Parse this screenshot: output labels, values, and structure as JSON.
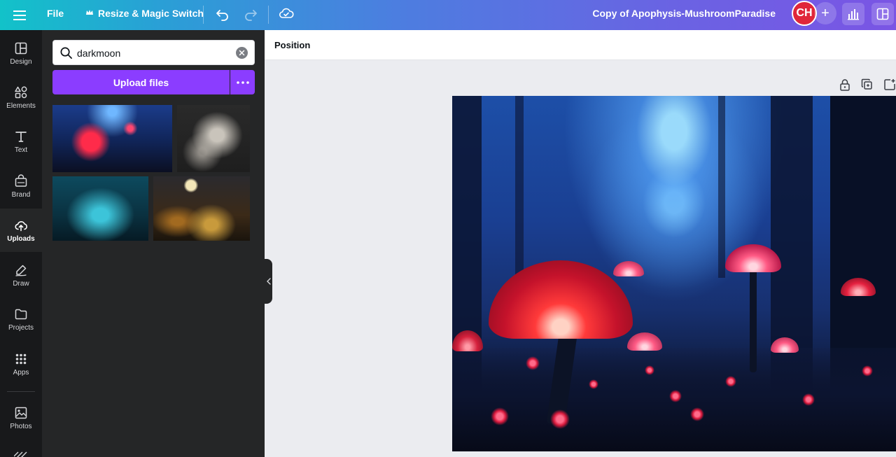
{
  "topbar": {
    "file_label": "File",
    "resize_label": "Resize & Magic Switch",
    "title": "Copy of Apophysis-MushroomParadise",
    "avatar_initials": "CH"
  },
  "rail": {
    "items": [
      {
        "id": "design",
        "label": "Design",
        "icon": "design-icon"
      },
      {
        "id": "elements",
        "label": "Elements",
        "icon": "elements-icon"
      },
      {
        "id": "text",
        "label": "Text",
        "icon": "text-icon"
      },
      {
        "id": "brand",
        "label": "Brand",
        "icon": "brand-icon"
      },
      {
        "id": "uploads",
        "label": "Uploads",
        "icon": "cloud-upload-icon",
        "active": true
      },
      {
        "id": "draw",
        "label": "Draw",
        "icon": "pen-icon"
      },
      {
        "id": "projects",
        "label": "Projects",
        "icon": "folder-icon"
      },
      {
        "id": "apps",
        "label": "Apps",
        "icon": "grid-icon"
      },
      {
        "id": "photos",
        "label": "Photos",
        "icon": "image-icon"
      }
    ]
  },
  "panel": {
    "search_value": "darkmoon",
    "upload_label": "Upload files",
    "thumbnails": [
      "mushroom-forest-thumbnail",
      "white-fractal-thumbnail",
      "teal-lake-thumbnail",
      "moonlit-village-thumbnail"
    ]
  },
  "context_bar": {
    "position_label": "Position"
  },
  "colors": {
    "accent": "#8b3dff",
    "rail_bg": "#18191b",
    "panel_bg": "#252627",
    "avatar": "#e0263a"
  }
}
